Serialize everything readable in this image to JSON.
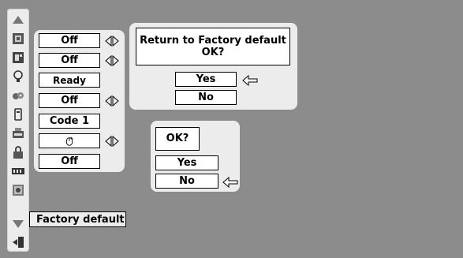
{
  "sidebar": {
    "icons": [
      "scroll-up-icon",
      "picture-adjust-icon",
      "image-icon",
      "lamp-icon",
      "fan-icon",
      "remote-icon",
      "usb-icon",
      "lock-icon",
      "film-icon",
      "settings-icon",
      "scroll-down-icon",
      "exit-icon"
    ]
  },
  "settings_panel": {
    "rows": [
      {
        "value": "Off",
        "has_arrows": true
      },
      {
        "value": "Off",
        "has_arrows": true
      },
      {
        "value": "Ready",
        "has_arrows": false
      },
      {
        "value": "Off",
        "has_arrows": true
      },
      {
        "value": "Code 1",
        "has_arrows": false
      },
      {
        "value": "",
        "icon": "mouse-icon",
        "has_arrows": true
      },
      {
        "value": "Off",
        "has_arrows": false
      }
    ]
  },
  "factory_dialog": {
    "message_line1": "Return to Factory default",
    "message_line2": "OK?",
    "yes_label": "Yes",
    "no_label": "No",
    "selected": "Yes"
  },
  "confirm_dialog": {
    "message": "OK?",
    "yes_label": "Yes",
    "no_label": "No",
    "selected": "No"
  },
  "tooltip": {
    "label": "Factory default"
  }
}
